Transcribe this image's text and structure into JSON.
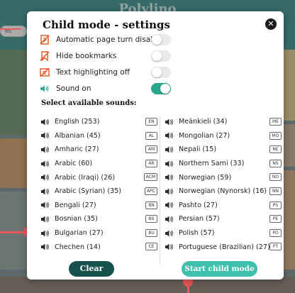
{
  "background": {
    "app_title": "Polylino",
    "pill_label": "es"
  },
  "modal": {
    "title": "Child mode - settings",
    "close_label": "✕",
    "settings": [
      {
        "label": "Automatic page turn disabled",
        "icon": "page-turn-off-icon",
        "enabled": false
      },
      {
        "label": "Hide bookmarks",
        "icon": "bookmark-off-icon",
        "enabled": false
      },
      {
        "label": "Text highlighting off",
        "icon": "highlight-off-icon",
        "enabled": false
      },
      {
        "label": "Sound on",
        "icon": "speaker-icon",
        "enabled": true
      }
    ],
    "sounds_heading": "Select available sounds:",
    "languages_left": [
      {
        "name": "English (253)",
        "code": "EN"
      },
      {
        "name": "Albanian (45)",
        "code": "AL"
      },
      {
        "name": "Amharic (27)",
        "code": "AM"
      },
      {
        "name": "Arabic (60)",
        "code": "AR"
      },
      {
        "name": "Arabic (Iraqi) (26)",
        "code": "ACM"
      },
      {
        "name": "Arabic (Syrian) (35)",
        "code": "APC"
      },
      {
        "name": "Bengali (27)",
        "code": "BN"
      },
      {
        "name": "Bosnian (35)",
        "code": "BS"
      },
      {
        "name": "Bulgarian (27)",
        "code": "BU"
      },
      {
        "name": "Chechen (14)",
        "code": "CE"
      }
    ],
    "languages_right": [
      {
        "name": "Meänkieli (34)",
        "code": "ME"
      },
      {
        "name": "Mongolian (27)",
        "code": "MO"
      },
      {
        "name": "Nepali (15)",
        "code": "NE"
      },
      {
        "name": "Northern Sami (33)",
        "code": "NS"
      },
      {
        "name": "Norwegian (59)",
        "code": "NO"
      },
      {
        "name": "Norwegian (Nynorsk) (16)",
        "code": "NN"
      },
      {
        "name": "Pashto (27)",
        "code": "PS"
      },
      {
        "name": "Persian (57)",
        "code": "PE"
      },
      {
        "name": "Polish (57)",
        "code": "PO"
      },
      {
        "name": "Portuguese (Brazilian) (27)",
        "code": "PT"
      }
    ],
    "clear_label": "Clear",
    "start_label": "Start child mode"
  },
  "colors": {
    "accent": "#2aa58e",
    "dark_button": "#16514e",
    "start_button": "#3ec0ad",
    "annotation": "#e8595a",
    "icon_orange": "#e0541c"
  }
}
